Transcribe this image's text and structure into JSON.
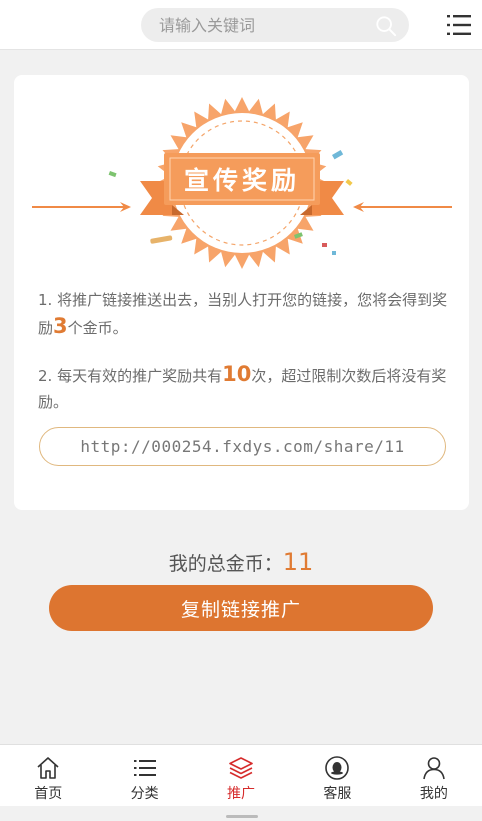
{
  "header": {
    "search_placeholder": "请输入关键词",
    "icons": {
      "search": "search-icon",
      "menu": "list-menu-icon"
    }
  },
  "promo": {
    "badge_title": "宣传奖励",
    "rule1_before": "1. 将推广链接推送出去，当别人打开您的链接，您将会得到奖励",
    "rule1_value": "3",
    "rule1_after": "个金币。",
    "rule2_before": "2. 每天有效的推广奖励共有",
    "rule2_value": "10",
    "rule2_after": "次，超过限制次数后将没有奖励。",
    "share_link": "http://000254.fxdys.com/share/11"
  },
  "summary": {
    "label": "我的总金币：",
    "coins": "11",
    "copy_button": "复制链接推广"
  },
  "nav": {
    "items": [
      {
        "label": "首页",
        "icon": "home-icon",
        "active": false
      },
      {
        "label": "分类",
        "icon": "list-icon",
        "active": false
      },
      {
        "label": "推广",
        "icon": "layers-icon",
        "active": true
      },
      {
        "label": "客服",
        "icon": "qq-icon",
        "active": false
      },
      {
        "label": "我的",
        "icon": "user-icon",
        "active": false
      }
    ]
  },
  "colors": {
    "accent": "#dd7530",
    "highlight": "#e07b33",
    "nav_active": "#d62c2c",
    "badge_orange": "#f59c5b"
  }
}
